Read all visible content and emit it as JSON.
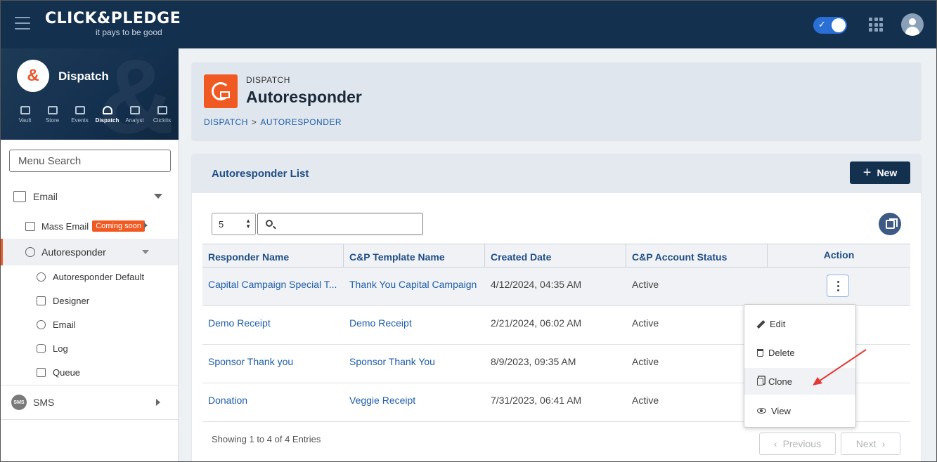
{
  "topbar": {
    "brand": "CLICK&PLEDGE",
    "tagline": "it pays to be good",
    "toggle_icon": "check-icon",
    "apps_icon": "apps-grid-icon",
    "avatar_icon": "user-avatar-icon"
  },
  "sidebar": {
    "app_badge": "&",
    "app_name": "Dispatch",
    "apps": [
      {
        "label": "Vault",
        "icon": "wallet-icon"
      },
      {
        "label": "Store",
        "icon": "cart-icon"
      },
      {
        "label": "Events",
        "icon": "calendar-icon"
      },
      {
        "label": "Dispatch",
        "icon": "broadcast-icon"
      },
      {
        "label": "Analyst",
        "icon": "bar-chart-icon"
      },
      {
        "label": "Clickits",
        "icon": "clickits-icon"
      }
    ],
    "menu_search_placeholder": "Menu Search",
    "email_label": "Email",
    "mass_email_label": "Mass Email",
    "coming_soon": "Coming soon",
    "autoresponder_label": "Autoresponder",
    "sub_items": [
      "Autoresponder Default",
      "Designer",
      "Email",
      "Log",
      "Queue"
    ],
    "sms_badge": "SMS",
    "sms_label": "SMS"
  },
  "header": {
    "kicker": "DISPATCH",
    "title": "Autoresponder",
    "breadcrumb": [
      "DISPATCH",
      ">",
      "AUTORESPONDER"
    ]
  },
  "list": {
    "title": "Autoresponder List",
    "new_label": "New",
    "page_size": "5",
    "search_value": "",
    "columns": [
      "Responder Name",
      "C&P Template Name",
      "Created Date",
      "C&P Account Status",
      "Action"
    ],
    "rows": [
      [
        "Capital Campaign Special Thank You",
        "Thank You Capital Campaign",
        "4/12/2024, 04:35 AM",
        "Active"
      ],
      [
        "Demo Receipt",
        "Demo Receipt",
        "2/21/2024, 06:02 AM",
        "Active"
      ],
      [
        "Sponsor Thank you",
        "Sponsor Thank You",
        "8/9/2023, 09:35 AM",
        "Active"
      ],
      [
        "Donation",
        "Veggie Receipt",
        "7/31/2023, 06:41 AM",
        "Active"
      ]
    ],
    "first_row_display": "Capital Campaign Special T...",
    "footer": "Showing 1 to 4 of 4 Entries",
    "prev_label": "Previous",
    "next_label": "Next"
  },
  "action_menu": {
    "items": [
      {
        "label": "Edit",
        "icon": "pencil-icon"
      },
      {
        "label": "Delete",
        "icon": "trash-icon"
      },
      {
        "label": "Clone",
        "icon": "clone-icon"
      },
      {
        "label": "View",
        "icon": "eye-icon"
      }
    ],
    "highlighted": "Clone"
  },
  "colors": {
    "navy": "#14304f",
    "accent_orange": "#f05a22",
    "link_blue": "#1f5ea8",
    "annotation_red": "#e53935"
  }
}
